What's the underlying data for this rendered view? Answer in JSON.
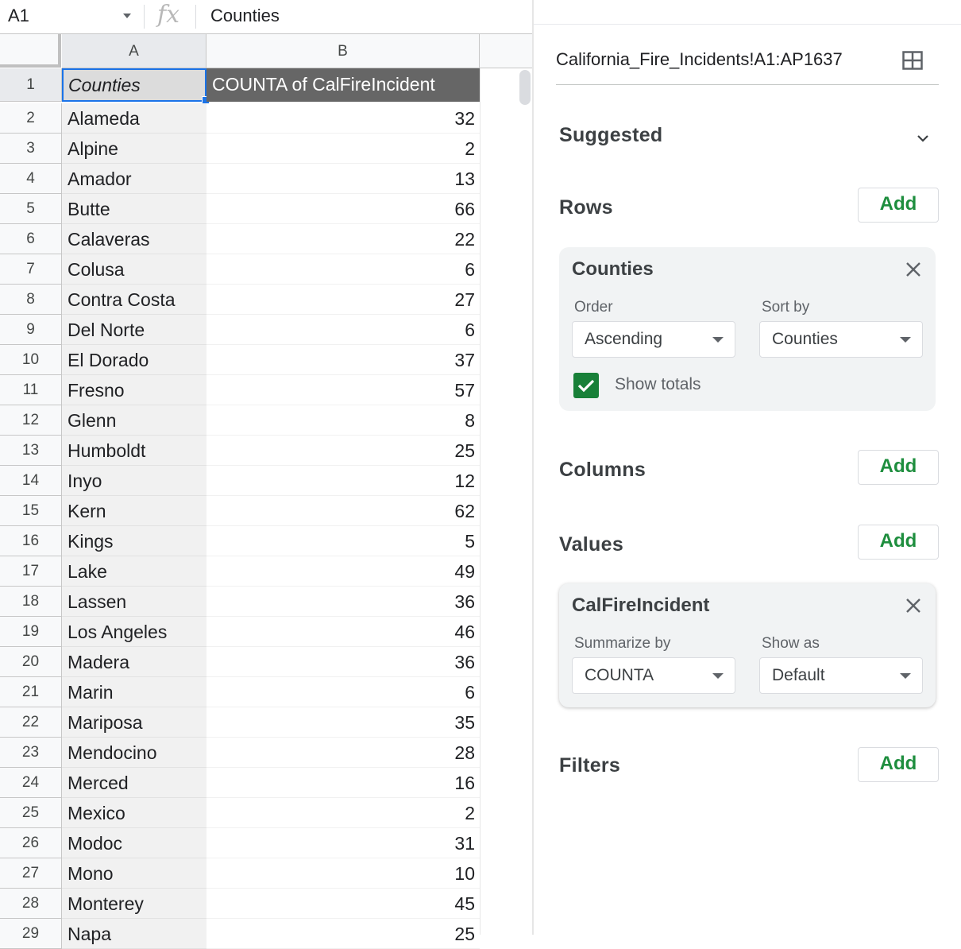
{
  "formula_bar": {
    "name_box": "A1",
    "fx_icon": "fx-icon",
    "value": "Counties"
  },
  "grid": {
    "col_headers": [
      "A",
      "B"
    ],
    "header_row": {
      "row": "1",
      "col_a": "Counties",
      "col_b": "COUNTA of CalFireIncident"
    },
    "rows": [
      {
        "num": "2",
        "county": "Alameda",
        "count": "32"
      },
      {
        "num": "3",
        "county": "Alpine",
        "count": "2"
      },
      {
        "num": "4",
        "county": "Amador",
        "count": "13"
      },
      {
        "num": "5",
        "county": "Butte",
        "count": "66"
      },
      {
        "num": "6",
        "county": "Calaveras",
        "count": "22"
      },
      {
        "num": "7",
        "county": "Colusa",
        "count": "6"
      },
      {
        "num": "8",
        "county": "Contra Costa",
        "count": "27"
      },
      {
        "num": "9",
        "county": "Del Norte",
        "count": "6"
      },
      {
        "num": "10",
        "county": "El Dorado",
        "count": "37"
      },
      {
        "num": "11",
        "county": "Fresno",
        "count": "57"
      },
      {
        "num": "12",
        "county": "Glenn",
        "count": "8"
      },
      {
        "num": "13",
        "county": "Humboldt",
        "count": "25"
      },
      {
        "num": "14",
        "county": "Inyo",
        "count": "12"
      },
      {
        "num": "15",
        "county": "Kern",
        "count": "62"
      },
      {
        "num": "16",
        "county": "Kings",
        "count": "5"
      },
      {
        "num": "17",
        "county": "Lake",
        "count": "49"
      },
      {
        "num": "18",
        "county": "Lassen",
        "count": "36"
      },
      {
        "num": "19",
        "county": "Los Angeles",
        "count": "46"
      },
      {
        "num": "20",
        "county": "Madera",
        "count": "36"
      },
      {
        "num": "21",
        "county": "Marin",
        "count": "6"
      },
      {
        "num": "22",
        "county": "Mariposa",
        "count": "35"
      },
      {
        "num": "23",
        "county": "Mendocino",
        "count": "28"
      },
      {
        "num": "24",
        "county": "Merced",
        "count": "16"
      },
      {
        "num": "25",
        "county": "Mexico",
        "count": "2"
      },
      {
        "num": "26",
        "county": "Modoc",
        "count": "31"
      },
      {
        "num": "27",
        "county": "Mono",
        "count": "10"
      },
      {
        "num": "28",
        "county": "Monterey",
        "count": "45"
      },
      {
        "num": "29",
        "county": "Napa",
        "count": "25"
      }
    ]
  },
  "panel": {
    "range": "California_Fire_Incidents!A1:AP1637",
    "range_icon": "grid-select-icon",
    "suggested": "Suggested",
    "rows_title": "Rows",
    "columns_title": "Columns",
    "values_title": "Values",
    "filters_title": "Filters",
    "add_label": "Add",
    "rows_card": {
      "title": "Counties",
      "order_label": "Order",
      "order_value": "Ascending",
      "sort_label": "Sort by",
      "sort_value": "Counties",
      "show_totals": "Show totals"
    },
    "values_card": {
      "title": "CalFireIncident",
      "summarize_label": "Summarize by",
      "summarize_value": "COUNTA",
      "show_as_label": "Show as",
      "show_as_value": "Default"
    }
  },
  "colors": {
    "accent_green": "#1e8e3e",
    "checkbox_green": "#188038",
    "selection_blue": "#1a73e8",
    "pivot_header_bg": "#666666"
  }
}
